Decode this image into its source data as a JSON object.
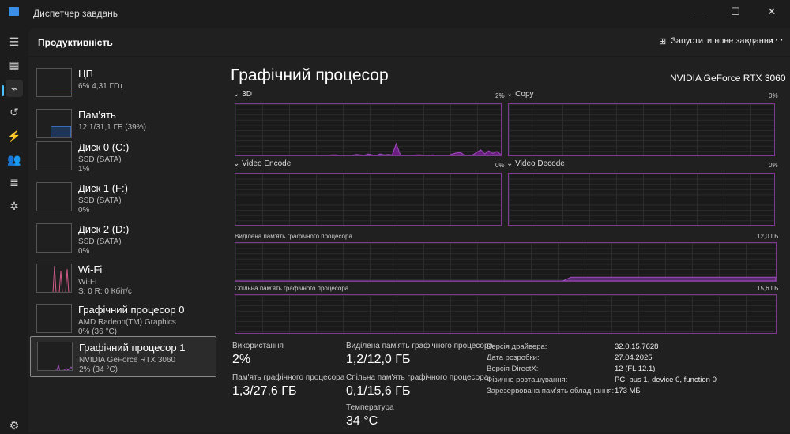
{
  "window": {
    "title": "Диспетчер завдань",
    "minimize": "—",
    "maximize": "☐",
    "close": "✕"
  },
  "header": {
    "title": "Продуктивність",
    "new_task": "Запустити нове завдання",
    "more": "···"
  },
  "rail": [
    "menu-icon",
    "processes-icon",
    "performance-icon",
    "app-history-icon",
    "startup-icon",
    "users-icon",
    "details-icon",
    "services-icon",
    "settings-icon"
  ],
  "sidebar": {
    "items": [
      {
        "name": "ЦП",
        "sub1": "6%  4,31 ГГц",
        "sub2": ""
      },
      {
        "name": "Пам'ять",
        "sub1": "12,1/31,1 ГБ (39%)",
        "sub2": ""
      },
      {
        "name": "Диск 0 (C:)",
        "sub1": "SSD (SATA)",
        "sub2": "1%"
      },
      {
        "name": "Диск 1 (F:)",
        "sub1": "SSD (SATA)",
        "sub2": "0%"
      },
      {
        "name": "Диск 2 (D:)",
        "sub1": "SSD (SATA)",
        "sub2": "0%"
      },
      {
        "name": "Wi-Fi",
        "sub1": "Wi-Fi",
        "sub2": "S: 0 R: 0 Кбіт/с"
      },
      {
        "name": "Графічний процесор 0",
        "sub1": "AMD Radeon(TM) Graphics",
        "sub2": "0%  (36 °C)"
      },
      {
        "name": "Графічний процесор 1",
        "sub1": "NVIDIA GeForce RTX 3060",
        "sub2": "2%  (34 °C)"
      }
    ]
  },
  "gpu": {
    "title": "Графічний процесор",
    "model": "NVIDIA GeForce RTX 3060",
    "engines": [
      {
        "label": "3D",
        "value": "2%"
      },
      {
        "label": "Copy",
        "value": "0%"
      },
      {
        "label": "Video Encode",
        "value": "0%"
      },
      {
        "label": "Video Decode",
        "value": "0%"
      }
    ],
    "dedicated_label": "Виділена пам'ять графічного процесора",
    "dedicated_max": "12,0 ГБ",
    "shared_label": "Спільна пам'ять графічного процесора",
    "shared_max": "15,6 ГБ",
    "stats": {
      "usage_label": "Використання",
      "usage": "2%",
      "ded_label": "Виділена пам'ять графічного процесора",
      "ded": "1,2/12,0 ГБ",
      "gpumem_label": "Пам'ять графічного процесора",
      "gpumem": "1,3/27,6 ГБ",
      "shared_label": "Спільна пам'ять графічного процесора",
      "shared": "0,1/15,6 ГБ",
      "temp_label": "Температура",
      "temp": "34 °C"
    },
    "info": [
      {
        "k": "Версія драйвера:",
        "v": "32.0.15.7628"
      },
      {
        "k": "Дата розробки:",
        "v": "27.04.2025"
      },
      {
        "k": "Версія DirectX:",
        "v": "12 (FL 12.1)"
      },
      {
        "k": "Фізичне розташування:",
        "v": "PCI bus 1, device 0, function 0"
      },
      {
        "k": "Зарезервована пам'ять обладнання:",
        "v": "173 МБ"
      }
    ]
  },
  "colors": {
    "gpu": "#a04cc0",
    "cpu": "#4aa3d8",
    "mem": "#3a6bb5",
    "wifi": "#d45a8a"
  },
  "chart_data": {
    "type": "area",
    "ylim": [
      0,
      100
    ],
    "series": [
      {
        "name": "3D",
        "values": [
          0,
          0,
          0,
          0,
          0,
          0,
          0,
          0,
          0,
          0,
          0,
          0,
          0,
          0,
          0,
          0,
          0,
          0,
          0,
          0,
          0,
          0,
          0,
          0,
          1,
          1,
          0,
          0,
          0,
          0,
          2,
          1,
          0,
          3,
          1,
          0,
          3,
          1,
          2,
          1,
          23,
          1,
          0,
          0,
          0,
          1,
          1,
          0,
          0,
          1,
          0,
          0,
          0,
          0,
          3,
          5,
          6,
          0,
          0,
          1,
          6,
          11,
          3,
          9,
          4,
          8,
          2
        ]
      },
      {
        "name": "Copy",
        "values": []
      },
      {
        "name": "Video Encode",
        "values": []
      },
      {
        "name": "Video Decode",
        "values": []
      },
      {
        "name": "Dedicated memory",
        "values": [
          0,
          0,
          0,
          0,
          0,
          0,
          0,
          0,
          0,
          0,
          0,
          0,
          0,
          0,
          0,
          0,
          0,
          0,
          0,
          0,
          0,
          0,
          0,
          0,
          0,
          0,
          0,
          0,
          0,
          0,
          0,
          0,
          0,
          0,
          0,
          0,
          0,
          0,
          0,
          0,
          0,
          10,
          10,
          10,
          10,
          10,
          10,
          10,
          10,
          10,
          10,
          10,
          10,
          10,
          10,
          10,
          10,
          10,
          10,
          10,
          10,
          10,
          10,
          10,
          10,
          10,
          10
        ]
      },
      {
        "name": "Shared memory",
        "values": []
      }
    ]
  }
}
